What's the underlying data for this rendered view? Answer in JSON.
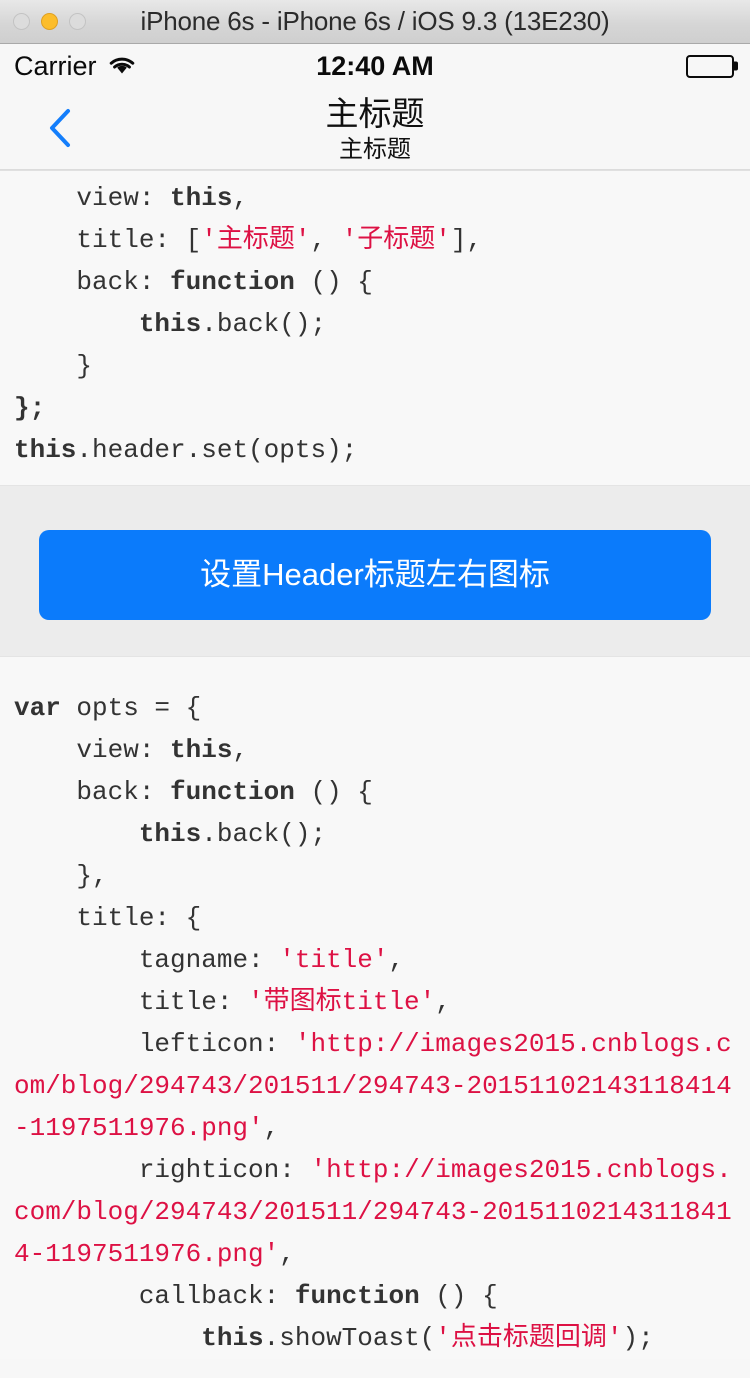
{
  "window": {
    "title": "iPhone 6s - iPhone 6s / iOS 9.3 (13E230)",
    "traffic_lights": [
      {
        "name": "close",
        "state": "disabled",
        "color": "#dcdcdc"
      },
      {
        "name": "minimize",
        "state": "enabled",
        "color": "#fcbd2b"
      },
      {
        "name": "zoom",
        "state": "disabled",
        "color": "#dcdcdc"
      }
    ]
  },
  "status_bar": {
    "carrier": "Carrier",
    "wifi_icon": "wifi-icon",
    "time": "12:40 AM",
    "battery_icon": "battery-full-icon"
  },
  "nav_bar": {
    "back_icon": "chevron-left-icon",
    "title": "主标题",
    "subtitle": "主标题"
  },
  "code_block_top": {
    "lines": [
      [
        {
          "t": "    view: ",
          "s": "plain"
        },
        {
          "t": "this",
          "s": "kw"
        },
        {
          "t": ",",
          "s": "plain"
        }
      ],
      [
        {
          "t": "    title: [",
          "s": "plain"
        },
        {
          "t": "'主标题'",
          "s": "str"
        },
        {
          "t": ", ",
          "s": "plain"
        },
        {
          "t": "'子标题'",
          "s": "str"
        },
        {
          "t": "],",
          "s": "plain"
        }
      ],
      [
        {
          "t": "    back: ",
          "s": "plain"
        },
        {
          "t": "function",
          "s": "kw"
        },
        {
          "t": " () {",
          "s": "plain"
        }
      ],
      [
        {
          "t": "        ",
          "s": "plain"
        },
        {
          "t": "this",
          "s": "kw"
        },
        {
          "t": ".back();",
          "s": "plain"
        }
      ],
      [
        {
          "t": "    }",
          "s": "plain"
        }
      ],
      [
        {
          "t": "};",
          "s": "kw"
        }
      ],
      [
        {
          "t": "this",
          "s": "kw"
        },
        {
          "t": ".header.set(opts);",
          "s": "plain"
        }
      ]
    ]
  },
  "button_section": {
    "label": "设置Header标题左右图标",
    "color": "#0b7bfb"
  },
  "code_block_bottom": {
    "lines": [
      [
        {
          "t": "var",
          "s": "kw"
        },
        {
          "t": " opts = {",
          "s": "plain"
        }
      ],
      [
        {
          "t": "    view: ",
          "s": "plain"
        },
        {
          "t": "this",
          "s": "kw"
        },
        {
          "t": ",",
          "s": "plain"
        }
      ],
      [
        {
          "t": "    back: ",
          "s": "plain"
        },
        {
          "t": "function",
          "s": "kw"
        },
        {
          "t": " () {",
          "s": "plain"
        }
      ],
      [
        {
          "t": "        ",
          "s": "plain"
        },
        {
          "t": "this",
          "s": "kw"
        },
        {
          "t": ".back();",
          "s": "plain"
        }
      ],
      [
        {
          "t": "    },",
          "s": "plain"
        }
      ],
      [
        {
          "t": "    title: {",
          "s": "plain"
        }
      ],
      [
        {
          "t": "        tagname: ",
          "s": "plain"
        },
        {
          "t": "'title'",
          "s": "str"
        },
        {
          "t": ",",
          "s": "plain"
        }
      ],
      [
        {
          "t": "        title: ",
          "s": "plain"
        },
        {
          "t": "'带图标title'",
          "s": "str"
        },
        {
          "t": ",",
          "s": "plain"
        }
      ],
      [
        {
          "t": "        lefticon: ",
          "s": "plain"
        },
        {
          "t": "'http://images2015.cnblogs.com/blog/294743/201511/294743-20151102143118414-1197511976.png'",
          "s": "str"
        },
        {
          "t": ",",
          "s": "plain"
        }
      ],
      [
        {
          "t": "        righticon: ",
          "s": "plain"
        },
        {
          "t": "'http://images2015.cnblogs.com/blog/294743/201511/294743-20151102143118414-1197511976.png'",
          "s": "str"
        },
        {
          "t": ",",
          "s": "plain"
        }
      ],
      [
        {
          "t": "        callback: ",
          "s": "plain"
        },
        {
          "t": "function",
          "s": "kw"
        },
        {
          "t": " () {",
          "s": "plain"
        }
      ],
      [
        {
          "t": "            ",
          "s": "plain"
        },
        {
          "t": "this",
          "s": "kw"
        },
        {
          "t": ".showToast(",
          "s": "plain"
        },
        {
          "t": "'点击标题回调'",
          "s": "str"
        },
        {
          "t": ");",
          "s": "plain"
        }
      ]
    ]
  }
}
